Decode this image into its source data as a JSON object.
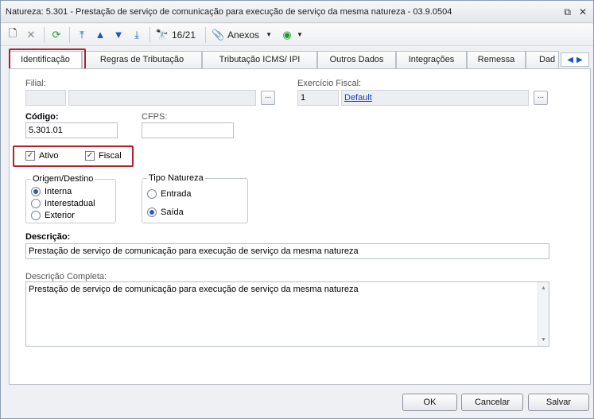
{
  "window": {
    "title": "Natureza: 5.301 - Prestação de serviço de comunicação para execução de serviço da mesma natureza - 03.9.0504",
    "restore_glyph": "⧉",
    "close_glyph": "✕"
  },
  "toolbar": {
    "record_position": "16/21",
    "attachments_label": "Anexos",
    "icons": [
      "new-document-icon",
      "delete-icon",
      "refresh-icon",
      "first-record-icon",
      "previous-record-icon",
      "next-record-icon",
      "last-record-icon",
      "binoculars-icon",
      "paperclip-icon",
      "globe-icon"
    ],
    "glyphs": {
      "new": "🗋",
      "delete": "✕",
      "refresh": "⟳",
      "first": "⤒",
      "previous": "▲",
      "next": "▼",
      "last": "⤓",
      "find": "🔭",
      "attach": "📎",
      "dropdown": "▼",
      "globe": "◉"
    }
  },
  "tabs": [
    {
      "label": "Identificação",
      "active": true
    },
    {
      "label": "Regras de Tributação"
    },
    {
      "label": "Tributação ICMS/ IPI"
    },
    {
      "label": "Outros Dados"
    },
    {
      "label": "Integrações"
    },
    {
      "label": "Remessa"
    },
    {
      "label": "Dad"
    }
  ],
  "tab_scroll": {
    "left": "◀",
    "right": "▶"
  },
  "form": {
    "filial_label": "Filial:",
    "filial_code": "",
    "filial_name": "",
    "exercicio_label": "Exercício Fiscal:",
    "exercicio_code": "1",
    "exercicio_name": "Default",
    "ellipsis": "...",
    "codigo_label": "Código:",
    "codigo_value": "5.301.01",
    "cfps_label": "CFPS:",
    "cfps_value": "",
    "ativo_label": "Ativo",
    "ativo_checked": true,
    "fiscal_label": "Fiscal",
    "fiscal_checked": true,
    "check_glyph": "✓",
    "origem_title": "Origem/Destino",
    "origem_options": [
      "Interna",
      "Interestadual",
      "Exterior"
    ],
    "origem_selected": "Interna",
    "tipo_title": "Tipo Natureza",
    "tipo_options": [
      "Entrada",
      "Saída"
    ],
    "tipo_selected": "Saída",
    "descricao_label": "Descrição:",
    "descricao_value": "Prestação de serviço de comunicação para execução de serviço da mesma natureza",
    "descricao_completa_label": "Descrição Completa:",
    "descricao_completa_value": "Prestação de serviço de comunicação para execução de serviço da mesma natureza",
    "scroll_up": "▲",
    "scroll_down": "▼"
  },
  "footer": {
    "ok_label": "OK",
    "cancel_label": "Cancelar",
    "save_label": "Salvar"
  },
  "colors": {
    "highlight": "#b0212b",
    "link": "#1a3fc8",
    "radio_selected": "#2a5cc4"
  }
}
